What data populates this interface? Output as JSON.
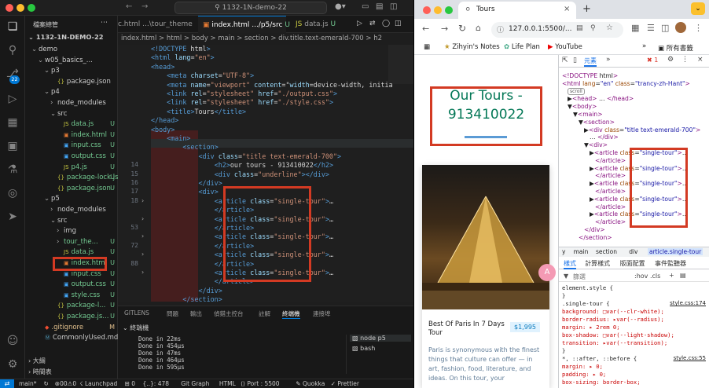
{
  "vscode": {
    "command_center": "1132-1N-demo-22",
    "sidebar_title": "檔案總管",
    "project_root": "1132-1N-DEMO-22",
    "tree": [
      {
        "label": "demo",
        "indent": 1,
        "arrow": "v",
        "kind": "folder",
        "badge": ""
      },
      {
        "label": "w05_basics_...",
        "indent": 2,
        "arrow": "v",
        "kind": "folder",
        "badge": ""
      },
      {
        "label": "p3",
        "indent": 3,
        "arrow": "v",
        "kind": "folder",
        "badge": ""
      },
      {
        "label": "package.json",
        "indent": 4,
        "arrow": "",
        "kind": "json",
        "badge": ""
      },
      {
        "label": "p4",
        "indent": 3,
        "arrow": "v",
        "kind": "folder",
        "badge": ""
      },
      {
        "label": "node_modules",
        "indent": 4,
        "arrow": ">",
        "kind": "folder",
        "badge": ""
      },
      {
        "label": "src",
        "indent": 4,
        "arrow": "v",
        "kind": "folder",
        "badge": ""
      },
      {
        "label": "data.js",
        "indent": 5,
        "arrow": "",
        "kind": "js",
        "badge": "U"
      },
      {
        "label": "index.html",
        "indent": 5,
        "arrow": "",
        "kind": "html",
        "badge": "U"
      },
      {
        "label": "input.css",
        "indent": 5,
        "arrow": "",
        "kind": "css",
        "badge": "U"
      },
      {
        "label": "output.css",
        "indent": 5,
        "arrow": "",
        "kind": "css",
        "badge": "U"
      },
      {
        "label": "p4.js",
        "indent": 5,
        "arrow": "",
        "kind": "js",
        "badge": "U"
      },
      {
        "label": "package-lock.js...",
        "indent": 4,
        "arrow": "",
        "kind": "json",
        "badge": "U"
      },
      {
        "label": "package.json",
        "indent": 4,
        "arrow": "",
        "kind": "json",
        "badge": "U"
      },
      {
        "label": "p5",
        "indent": 3,
        "arrow": "v",
        "kind": "folder",
        "badge": ""
      },
      {
        "label": "node_modules",
        "indent": 4,
        "arrow": ">",
        "kind": "folder",
        "badge": ""
      },
      {
        "label": "src",
        "indent": 4,
        "arrow": "v",
        "kind": "folder",
        "badge": ""
      },
      {
        "label": "img",
        "indent": 5,
        "arrow": ">",
        "kind": "folder",
        "badge": ""
      },
      {
        "label": "tour_the...",
        "indent": 5,
        "arrow": ">",
        "kind": "folder",
        "badge": "U"
      },
      {
        "label": "data.js",
        "indent": 5,
        "arrow": "",
        "kind": "js",
        "badge": "U"
      },
      {
        "label": "index.html",
        "indent": 5,
        "arrow": "",
        "kind": "html",
        "badge": "U"
      },
      {
        "label": "input.css",
        "indent": 5,
        "arrow": "",
        "kind": "css",
        "badge": "U"
      },
      {
        "label": "output.css",
        "indent": 5,
        "arrow": "",
        "kind": "css",
        "badge": "U"
      },
      {
        "label": "style.css",
        "indent": 5,
        "arrow": "",
        "kind": "css",
        "badge": "U"
      },
      {
        "label": "package-l...",
        "indent": 4,
        "arrow": "",
        "kind": "json",
        "badge": "U"
      },
      {
        "label": "package.js...",
        "indent": 4,
        "arrow": "",
        "kind": "json",
        "badge": "U"
      },
      {
        "label": ".gitignore",
        "indent": 2,
        "arrow": "",
        "kind": "git",
        "badge": "M"
      },
      {
        "label": "CommonlyUsed.md",
        "indent": 2,
        "arrow": "",
        "kind": "md",
        "badge": ""
      }
    ],
    "outline_label": "大綱",
    "timeline_label": "時間表",
    "tabs": [
      {
        "label": "c.html ...\\tour_theme",
        "active": false
      },
      {
        "label": "index.html .../p5/src",
        "active": true,
        "badge": "U"
      },
      {
        "label": "data.js",
        "active": false,
        "badge": "U"
      }
    ],
    "breadcrumb": "index.html > html > body > main > section > div.title.text-emerald-700 > h2",
    "code_lines": [
      {
        "n": "",
        "t": "<!DOCTYPE html>"
      },
      {
        "n": "",
        "t": "<html lang=\"en\">"
      },
      {
        "n": "",
        "t": "<head>"
      },
      {
        "n": "",
        "t": "    <meta charset=\"UTF-8\">"
      },
      {
        "n": "",
        "t": "    <meta name=\"viewport\" content=\"width=device-width, initia"
      },
      {
        "n": "",
        "t": "    <link rel=\"stylesheet\" href=\"./output.css\">"
      },
      {
        "n": "",
        "t": "    <link rel=\"stylesheet\" href=\"./style.css\">"
      },
      {
        "n": "",
        "t": "    <title>Tours</title>"
      },
      {
        "n": "",
        "t": "</head>"
      },
      {
        "n": "",
        "t": "<body>"
      },
      {
        "n": "",
        "t": "    <main>"
      },
      {
        "n": "",
        "t": "        <section>"
      },
      {
        "n": "",
        "t": "            <div class=\"title text-emerald-700\">"
      },
      {
        "n": "14",
        "t": "                <h2>our tours - 913410022</h2>"
      },
      {
        "n": "15",
        "t": "                <div class=\"underline\"></div>"
      },
      {
        "n": "16",
        "t": "            </div>"
      },
      {
        "n": "17",
        "t": "            <div>"
      },
      {
        "n": "18",
        "t": "                <article class=\"single-tour\">…"
      },
      {
        "n": "",
        "t": "                </article>"
      },
      {
        "n": "",
        "t": "                <article class=\"single-tour\">…"
      },
      {
        "n": "53",
        "t": "                </article>"
      },
      {
        "n": "",
        "t": "                <article class=\"single-tour\">…"
      },
      {
        "n": "72",
        "t": "                </article>"
      },
      {
        "n": "",
        "t": "                <article class=\"single-tour\">…"
      },
      {
        "n": "88",
        "t": "                </article>"
      },
      {
        "n": "",
        "t": "                <article class=\"single-tour\">…"
      },
      {
        "n": "",
        "t": "                </article>"
      },
      {
        "n": "",
        "t": "            </div>"
      },
      {
        "n": "",
        "t": "        </section>"
      }
    ],
    "panel_tabs": [
      "GITLENS",
      "問題",
      "輸出",
      "偵錯主控台",
      "註解",
      "終端機",
      "連接埠"
    ],
    "terminal_label": "終端機",
    "terminal_lines": [
      "Done in 22ms",
      "Done in 454µs",
      "Done in 47ms",
      "Done in 464µs",
      "Done in 595µs"
    ],
    "terminal_sessions": [
      "node p5",
      "bash"
    ],
    "status_items": [
      "main*",
      "↻",
      "⊗00⚠0",
      "☇ Launchpad",
      "⊞ 0",
      "{..}: 478",
      "Git Graph",
      "HTML",
      "⟨⟩ Port : 5500",
      "✎ Quokka",
      "✓ Prettier"
    ],
    "activity_badge": "22"
  },
  "chrome": {
    "tab_title": "Tours",
    "url": "127.0.0.1:5500/...",
    "bookmarks": [
      "Zihyin's Notes",
      "Life Plan",
      "YouTube"
    ],
    "all_bookmarks": "所有書籤",
    "page": {
      "title_line1": "Our Tours -",
      "title_line2": "913410022",
      "card_name": "Best Of Paris In 7 Days Tour",
      "card_price": "$1,995",
      "card_text": "Paris is synonymous with the finest things that culture can offer — in art, fashion, food, literature, and ideas. On this tour, your"
    },
    "devtools": {
      "tab_elements": "元素",
      "error_count": "1",
      "dom_lines": [
        {
          "d": 0,
          "t": "<!DOCTYPE html>"
        },
        {
          "d": 0,
          "t": "<html lang=\"en\" class=\"trancy-zh-Hant\">"
        },
        {
          "d": 1,
          "t": "scroll"
        },
        {
          "d": 1,
          "t": "▶<head> … </head>"
        },
        {
          "d": 1,
          "t": "▼<body>"
        },
        {
          "d": 2,
          "t": "▼<main>"
        },
        {
          "d": 3,
          "t": "▼<section>"
        },
        {
          "d": 4,
          "t": "▶<div class=\"title text-emerald-700\">"
        },
        {
          "d": 5,
          "t": "… </div>"
        },
        {
          "d": 4,
          "t": "▼<div>"
        },
        {
          "d": 5,
          "t": "▶<article class=\"single-tour\">…"
        },
        {
          "d": 6,
          "t": "</article>"
        },
        {
          "d": 5,
          "t": "▶<article class=\"single-tour\">…"
        },
        {
          "d": 6,
          "t": "</article>"
        },
        {
          "d": 5,
          "t": "▶<article class=\"single-tour\">…"
        },
        {
          "d": 6,
          "t": "</article>"
        },
        {
          "d": 5,
          "t": "▶<article class=\"single-tour\">…"
        },
        {
          "d": 6,
          "t": "</article>"
        },
        {
          "d": 5,
          "t": "▶<article class=\"single-tour\">…"
        },
        {
          "d": 6,
          "t": "</article>"
        },
        {
          "d": 4,
          "t": "</div>"
        },
        {
          "d": 3,
          "t": "</section>"
        }
      ],
      "crumbs": [
        "y",
        "main",
        "section",
        "div",
        "article.single-tour"
      ],
      "style_tabs": [
        "樣式",
        "計算樣式",
        "版面配置",
        "事件監聽器"
      ],
      "filter_placeholder": "篩選",
      "filter_tools": ":hov .cls",
      "css_lines": [
        {
          "t": "element.style {",
          "src": ""
        },
        {
          "t": "}",
          "src": ""
        },
        {
          "t": ".single-tour {",
          "src": "style.css:174"
        },
        {
          "t": "  background: □var(--clr-white);",
          "src": ""
        },
        {
          "t": "  border-radius: ▸var(--radius);",
          "src": ""
        },
        {
          "t": "  margin: ▸ 2rem 0;",
          "src": ""
        },
        {
          "t": "  box-shadow: □var(--light-shadow);",
          "src": ""
        },
        {
          "t": "  transition: ▸var(--transition);",
          "src": ""
        },
        {
          "t": "}",
          "src": ""
        },
        {
          "t": "*, ::after, ::before {",
          "src": "style.css:55"
        },
        {
          "t": "  margin: ▸ 0;",
          "src": ""
        },
        {
          "t": "  padding: ▸ 0;",
          "src": ""
        },
        {
          "t": "  box-sizing: border-box;",
          "src": ""
        }
      ]
    }
  },
  "colors": {
    "emerald": "#047857",
    "highlight_red": "#d33a23",
    "vscode_bg": "#1e1e1e"
  }
}
